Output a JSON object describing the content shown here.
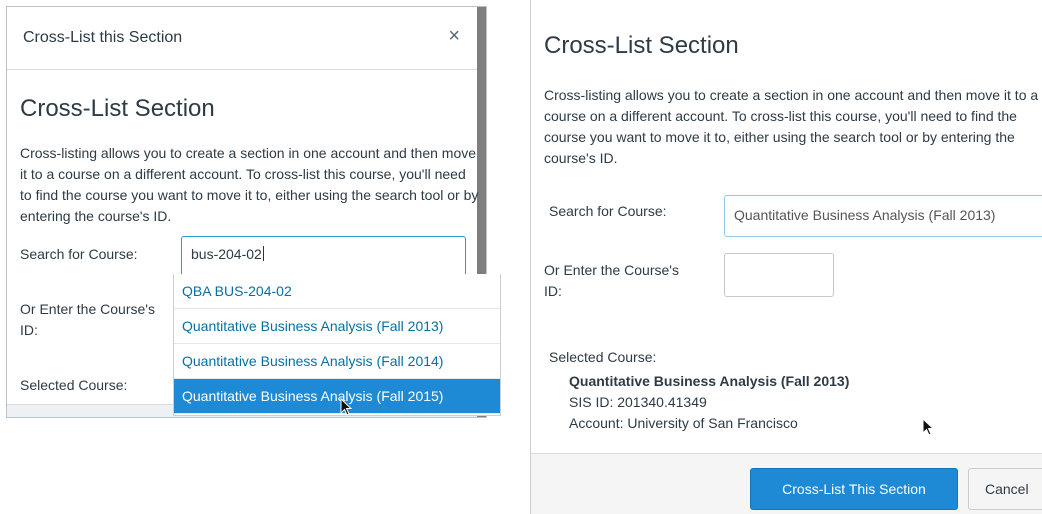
{
  "left_dialog": {
    "title": "Cross-List this Section",
    "close_glyph": "×",
    "heading": "Cross-List Section",
    "description": "Cross-listing allows you to create a section in one account and then move it to a course on a different account. To cross-list this course, you'll need to find the course you want to move it to, either using the search tool or by entering the course's ID.",
    "search_label": "Search for Course:",
    "search_value": "bus-204-02",
    "id_label_line1": "Or Enter the Course's",
    "id_label_line2": "ID:",
    "selected_label": "Selected Course:",
    "dropdown_options": [
      "QBA BUS-204-02",
      "Quantitative Business Analysis (Fall 2013)",
      "Quantitative Business Analysis (Fall 2014)",
      "Quantitative Business Analysis (Fall 2015)"
    ]
  },
  "right_panel": {
    "heading": "Cross-List Section",
    "description": "Cross-listing allows you to create a section in one account and then move it to a course on a different account. To cross-list this course, you'll need to find the course you want to move it to, either using the search tool or by entering the course's ID.",
    "search_label": "Search for Course:",
    "search_value": "Quantitative Business Analysis (Fall 2013)",
    "id_label_line1": "Or Enter the Course's",
    "id_label_line2": "ID:",
    "selected_label": "Selected Course:",
    "selected_name": "Quantitative Business Analysis (Fall 2013)",
    "sis_id": "SIS ID: 201340.41349",
    "account": "Account: University of San Francisco",
    "primary_button": "Cross-List This Section",
    "cancel_button": "Cancel"
  },
  "colors": {
    "accent": "#1e8ad6",
    "link": "#0770a3",
    "text": "#2d3b45"
  },
  "icons": [
    "close-icon",
    "mouse-pointer-icon"
  ]
}
